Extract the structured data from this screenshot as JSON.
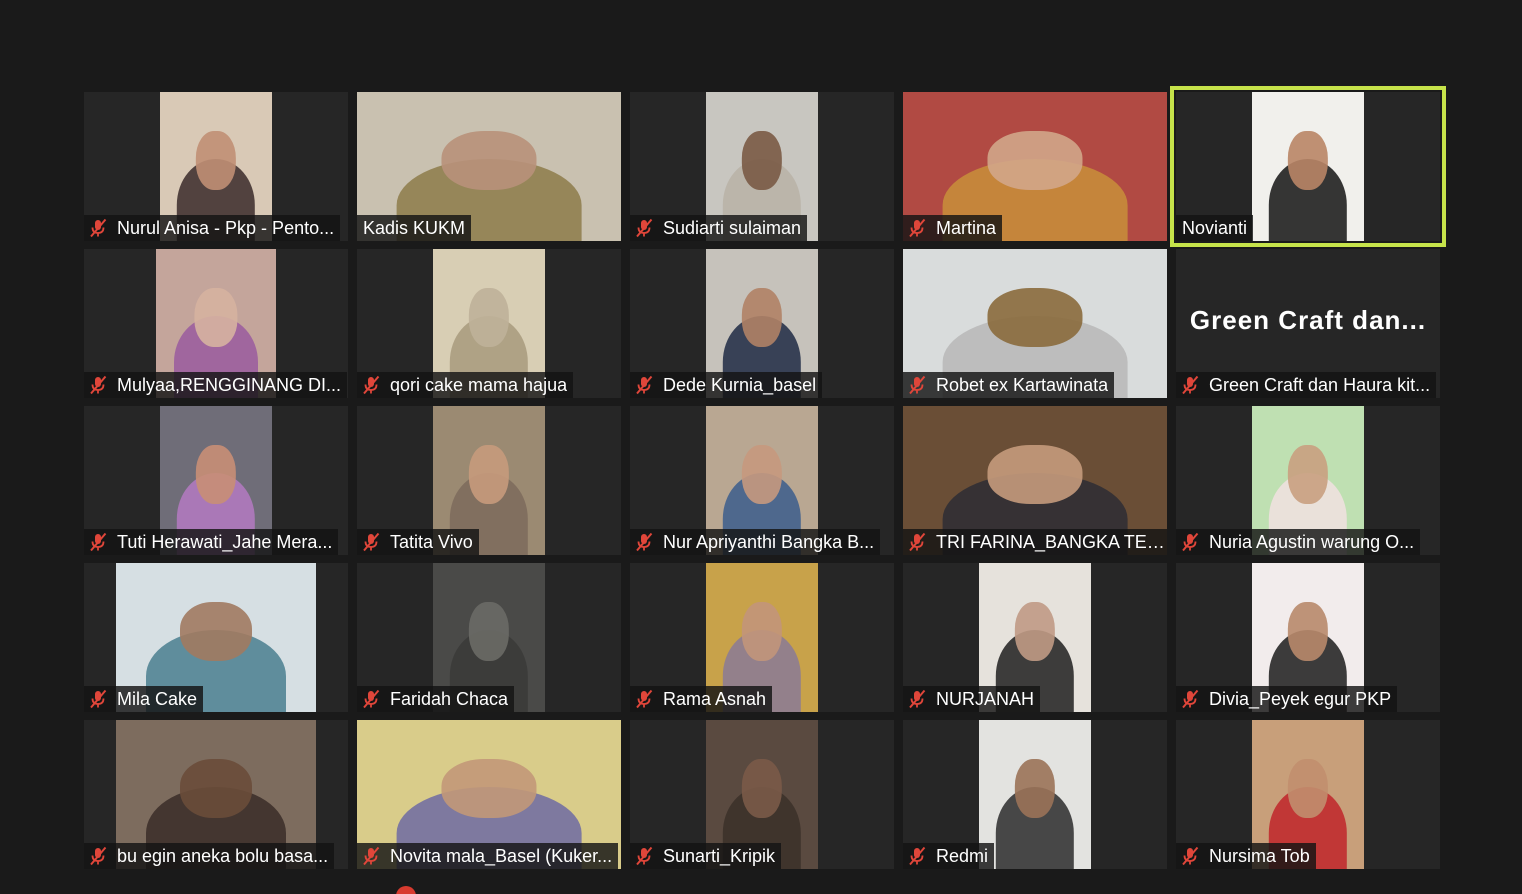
{
  "app": {
    "active_speaker": "Novianti"
  },
  "colors": {
    "background": "#1a1a1a",
    "tile": "#262626",
    "active_border": "#c6e34a",
    "mic_muted": "#e0463a",
    "name_text": "#ffffff"
  },
  "participants": [
    {
      "name": "Nurul Anisa - Pkp - Pento...",
      "muted": true,
      "video": "narrow",
      "bg": "#d9c9b6",
      "skin": "#c08f74",
      "cloth": "#3a2a2a"
    },
    {
      "name": "Kadis KUKM",
      "muted": false,
      "video": "full",
      "bg": "#c9c1b0",
      "skin": "#b8917a",
      "cloth": "#8d7b4a"
    },
    {
      "name": "Sudiarti sulaiman",
      "muted": true,
      "video": "narrow",
      "bg": "#c8c6c0",
      "skin": "#7a5a45",
      "cloth": "#b8b2a6"
    },
    {
      "name": "Martina",
      "muted": true,
      "video": "full",
      "bg": "#b14a43",
      "skin": "#d2a68a",
      "cloth": "#c98f3a"
    },
    {
      "name": "Novianti",
      "muted": false,
      "video": "narrow",
      "bg": "#f1f0ec",
      "skin": "#b98566",
      "cloth": "#141414",
      "active": true
    },
    {
      "name": "Mulyaa,RENGGINANG DI...",
      "muted": true,
      "video": "mid",
      "bg": "#c4a59b",
      "skin": "#d6b3a0",
      "cloth": "#9a5a9f"
    },
    {
      "name": "qori cake mama hajua",
      "muted": true,
      "video": "narrow",
      "bg": "#d8ceb4",
      "skin": "#bfb199",
      "cloth": "#a89a7c"
    },
    {
      "name": "Dede Kurnia_basel",
      "muted": true,
      "video": "narrow",
      "bg": "#c6c2bb",
      "skin": "#b08266",
      "cloth": "#1f2a44"
    },
    {
      "name": "Robet ex Kartawinata",
      "muted": true,
      "video": "full",
      "bg": "#d9dcdc",
      "skin": "#8a6a3c",
      "cloth": "#b7b7b7"
    },
    {
      "name": "Green Craft dan Haura kit...",
      "muted": true,
      "video": "screen",
      "screen_title": "Green  Craft  dan..."
    },
    {
      "name": "Tuti Herawati_Jahe Mera...",
      "muted": true,
      "video": "narrow",
      "bg": "#6f6d78",
      "skin": "#c88e76",
      "cloth": "#b57ac2"
    },
    {
      "name": "Tatita Vivo",
      "muted": true,
      "video": "narrow",
      "bg": "#9b8a72",
      "skin": "#c79a7c",
      "cloth": "#7d6a5c"
    },
    {
      "name": "Nur Apriyanthi Bangka B...",
      "muted": true,
      "video": "narrow",
      "bg": "#b9a792",
      "skin": "#c7997e",
      "cloth": "#3b5d8c"
    },
    {
      "name": "TRI FARINA_BANGKA TEN...",
      "muted": true,
      "video": "full",
      "bg": "#6a4e36",
      "skin": "#c59b7c",
      "cloth": "#2d2d34"
    },
    {
      "name": "Nuria Agustin warung O...",
      "muted": true,
      "video": "narrow",
      "bg": "#bfe0b2",
      "skin": "#c9a080",
      "cloth": "#f1e0e0"
    },
    {
      "name": "Mila Cake",
      "muted": true,
      "video": "wide",
      "bg": "#d6dfe3",
      "skin": "#a17a60",
      "cloth": "#4a7f8f"
    },
    {
      "name": "Faridah Chaca",
      "muted": true,
      "video": "narrow",
      "bg": "#4a4a48",
      "skin": "#6a6a66",
      "cloth": "#3a3a38"
    },
    {
      "name": "Rama Asnah",
      "muted": true,
      "video": "narrow",
      "bg": "#c8a24a",
      "skin": "#c2957a",
      "cloth": "#8a7a96"
    },
    {
      "name": "NURJANAH",
      "muted": true,
      "video": "narrow",
      "bg": "#e6e2dc",
      "skin": "#c09a85",
      "cloth": "#1e1e1e"
    },
    {
      "name": "Divia_Peyek egur PKP",
      "muted": true,
      "video": "narrow",
      "bg": "#f2ecec",
      "skin": "#b88a6c",
      "cloth": "#1c1c1c"
    },
    {
      "name": "bu egin aneka bolu basa...",
      "muted": true,
      "video": "wide",
      "bg": "#7d6c5e",
      "skin": "#6a4c3a",
      "cloth": "#3a2d28"
    },
    {
      "name": "Novita mala_Basel (Kuker...",
      "muted": true,
      "video": "full",
      "bg": "#d9cc8a",
      "skin": "#c29878",
      "cloth": "#6d6aa2"
    },
    {
      "name": "Sunarti_Kripik",
      "muted": true,
      "video": "narrow",
      "bg": "#5a4a40",
      "skin": "#7a5a48",
      "cloth": "#3b3029"
    },
    {
      "name": "Redmi",
      "muted": true,
      "video": "narrow",
      "bg": "#e3e3e0",
      "skin": "#9a7258",
      "cloth": "#2b2b2b"
    },
    {
      "name": "Nursima Tob",
      "muted": true,
      "video": "narrow",
      "bg": "#c89f7a",
      "skin": "#c18e6e",
      "cloth": "#c0242a"
    }
  ]
}
